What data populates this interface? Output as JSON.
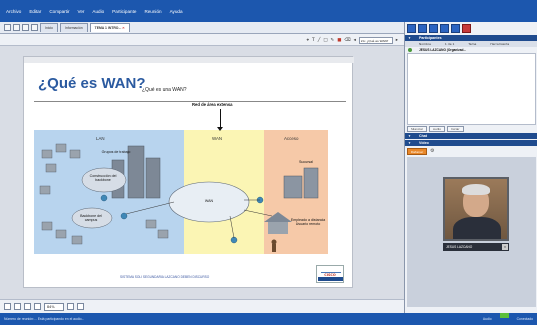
{
  "menu": [
    "Archivo",
    "Editar",
    "Compartir",
    "Ver",
    "Audio",
    "Participante",
    "Reunión",
    "Ayuda"
  ],
  "tabs": [
    {
      "label": "Inicio"
    },
    {
      "label": "Información"
    },
    {
      "label": "TEMA 1 INTRO...",
      "active": true
    }
  ],
  "toolbar": {
    "page_field": "2A: ¿Qué es WAN?"
  },
  "slide": {
    "title": "¿Qué es WAN?",
    "subtitle": "¿Qué es una WAN?",
    "ext_network": "Red de área extensa",
    "zones": {
      "lan": "LAN",
      "wan": "WAN",
      "access": "Acceso"
    },
    "labels": {
      "workgroups": "Grupos de trabajo",
      "backbone_build": "Construcción del backbone",
      "campus_backbone": "Backbone del campus",
      "wan_cloud": "WAN",
      "branch": "Sucursal",
      "remote": "Empleado a distancia Usuario remoto"
    },
    "footer": "SISTEMA SOLI SEGUNDARIA LAZCANO DEBEN DISCURSO",
    "logo": "CISCO"
  },
  "bottom": {
    "zoom": "84%"
  },
  "status": {
    "left": "Número de reunión:...   Está participando en el audio...",
    "right_label": "Audio",
    "right_user": "Conectado"
  },
  "panel": {
    "participants_title": "Participantes",
    "columns": [
      "Nombre",
      "1 de 1",
      "Tema",
      "Herramienta"
    ],
    "participant": "JESUS LAZCANO (Organizad...",
    "buttons": [
      "Silenciar",
      "Audio",
      "Iniciar"
    ],
    "chat_title": "Chat",
    "video_title": "Vídeo",
    "video_button": "Detener",
    "cam_name": "JESUS LAZCANO"
  },
  "colors": {
    "menubar": "#1c57ae",
    "title": "#2b5aa0",
    "lan": "#b8d4ee",
    "wan": "#fbf5b4",
    "access": "#f6c9a8"
  }
}
